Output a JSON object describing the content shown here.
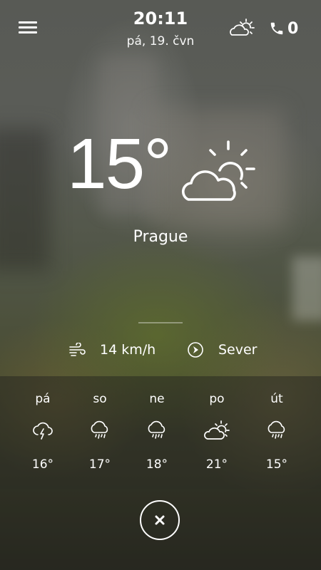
{
  "header": {
    "time": "20:11",
    "date": "pá, 19. čvn",
    "weather_icon": "partly-cloudy-day-icon",
    "call_count": "0"
  },
  "current": {
    "temperature": "15°",
    "icon": "partly-cloudy-day-icon",
    "city": "Prague",
    "wind_speed": "14 km/h",
    "wind_direction": "Sever"
  },
  "forecast": [
    {
      "day": "pá",
      "icon": "thunderstorm-icon",
      "temp": "16°"
    },
    {
      "day": "so",
      "icon": "rain-cloud-icon",
      "temp": "17°"
    },
    {
      "day": "ne",
      "icon": "rain-cloud-icon",
      "temp": "18°"
    },
    {
      "day": "po",
      "icon": "partly-cloudy-day-icon",
      "temp": "21°"
    },
    {
      "day": "út",
      "icon": "rain-cloud-icon",
      "temp": "15°"
    }
  ],
  "colors": {
    "text": "#ffffff",
    "panel": "#1e201c"
  }
}
